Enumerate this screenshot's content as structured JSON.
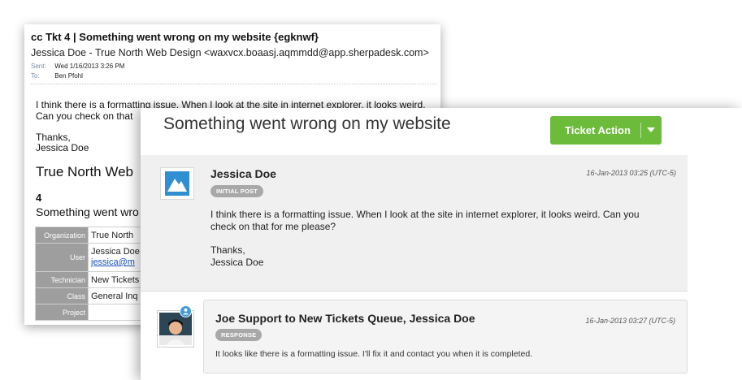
{
  "email": {
    "subject": "cc Tkt 4 | Something went wrong on my website {egknwf}",
    "from": "Jessica Doe - True North Web Design <waxvcx.boaasj.aqmmdd@app.sherpadesk.com>",
    "sent_label": "Sent:",
    "sent_value": "Wed 1/16/2013 3:26 PM",
    "to_label": "To:",
    "to_value": "Ben Pfohl",
    "body_line1": "I think there is a formatting issue. When I look at the site in internet explorer, it looks weird.",
    "body_line2": "Can you check on that",
    "thanks": "Thanks,",
    "signature": "Jessica Doe",
    "company": "True North Web",
    "ticket_number": "4",
    "ticket_subject": "Something went wro",
    "table": [
      {
        "label": "Organization",
        "value": "True North"
      },
      {
        "label": "User",
        "value": "Jessica Doe",
        "value2": "jessica@m"
      },
      {
        "label": "Technician",
        "value": "New Tickets"
      },
      {
        "label": "Class",
        "value": "General Inq"
      },
      {
        "label": "Project",
        "value": ""
      }
    ]
  },
  "ticket": {
    "title": "Something went wrong on my website",
    "action_label": "Ticket Action",
    "accent_color": "#6dbb3a",
    "posts": [
      {
        "author": "Jessica Doe",
        "badge": "INITIAL POST",
        "timestamp": "16-Jan-2013 03:25 (UTC-5)",
        "text_line1": "I think there is a formatting issue. When I look at the site in internet explorer, it looks weird. Can you",
        "text_line2": "check on that for me please?",
        "thanks": "Thanks,",
        "signature": "Jessica Doe"
      },
      {
        "author": "Joe Support to New Tickets Queue, Jessica Doe",
        "badge": "RESPONSE",
        "timestamp": "16-Jan-2013 03:27 (UTC-5)",
        "text": "It looks like there is a formatting issue. I'll fix it and contact you when it is completed."
      }
    ]
  }
}
